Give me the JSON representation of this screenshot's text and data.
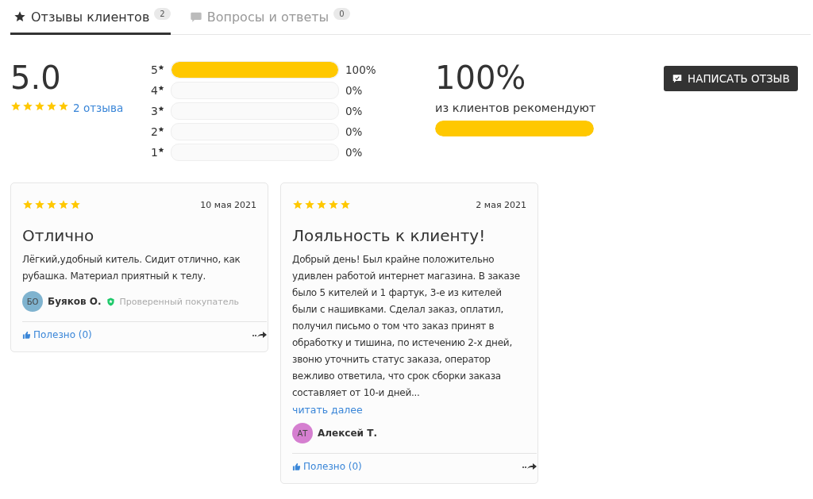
{
  "tabs": [
    {
      "label": "Отзывы клиентов",
      "count": "2",
      "selected": true,
      "kind": "star"
    },
    {
      "label": "Вопросы и ответы",
      "count": "0",
      "selected": false,
      "kind": "chat"
    }
  ],
  "summary": {
    "average": "5.0",
    "stars": 5,
    "count_link": "2 отзыва"
  },
  "histogram": [
    {
      "label": "5",
      "level": 1,
      "percent": "100%"
    },
    {
      "label": "4",
      "level": 0,
      "percent": "0%"
    },
    {
      "label": "3",
      "level": 0,
      "percent": "0%"
    },
    {
      "label": "2",
      "level": 0,
      "percent": "0%"
    },
    {
      "label": "1",
      "level": 0,
      "percent": "0%"
    }
  ],
  "recommend": {
    "value": "100%",
    "caption": "из клиентов рекомендуют",
    "level": 1
  },
  "write_button": "НАПИСАТЬ ОТЗЫВ",
  "reviews": [
    {
      "stars": 5,
      "date": "10 мая 2021",
      "title": "Отлично",
      "text": "Лёгкий,удобный китель. Сидит отлично, как рубашка. Материал приятный к телу.",
      "initials": "БО",
      "color": "#7fb3cf",
      "author": "Буяков О.",
      "badge": "Проверенный покупатель",
      "helpful": "Полезно (0)"
    },
    {
      "stars": 5,
      "date": "2 мая 2021",
      "title": "Лояльность к клиенту!",
      "text": "Добрый день! Был крайне положительно удивлен работой интернет магазина. В заказе было 5 кителей и 1 фартук, 3-е из кителей были с нашивками. Сделал заказ, оплатил, получил письмо о том что заказ принят в обработку и тишина, по истечению 2-х дней, звоню уточнить статус заказа, оператор вежливо ответила, что срок сборки заказа составляет от 10-и дней...",
      "read_more": "читать далее",
      "initials": "АТ",
      "color": "#d57fd0",
      "author": "Алексей Т.",
      "helpful": "Полезно (0)"
    }
  ]
}
